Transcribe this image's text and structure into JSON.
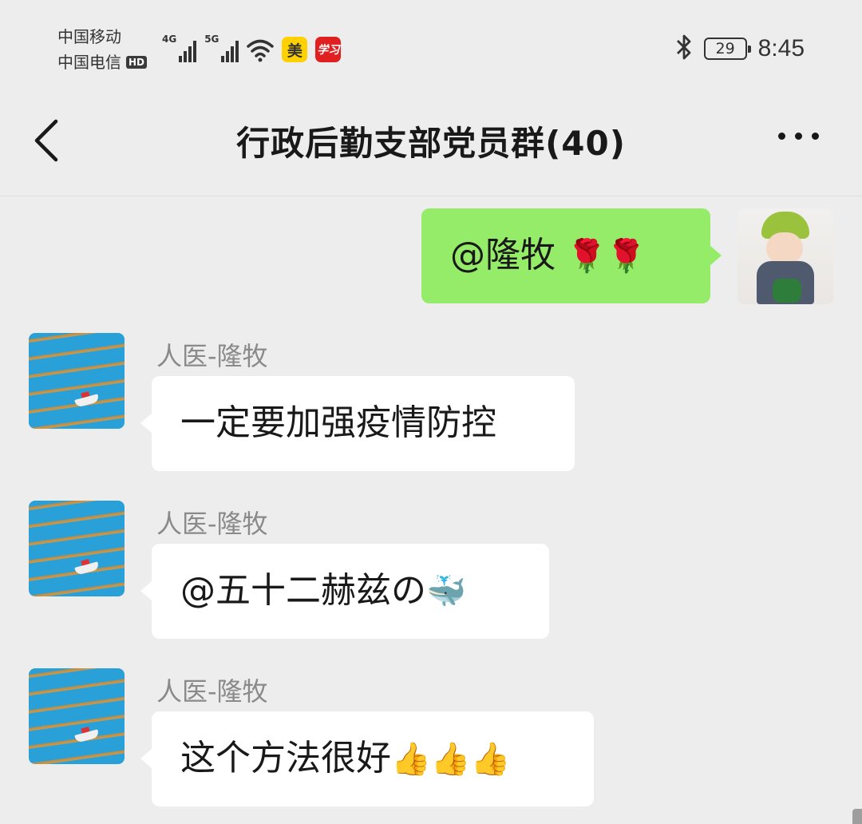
{
  "status_bar": {
    "carrier1": "中国移动",
    "carrier2": "中国电信",
    "hd_badge": "HD",
    "net1": "4G",
    "net2": "5G",
    "app_badge1": "美",
    "app_badge2": "学习",
    "battery": "29",
    "time": "8:45"
  },
  "header": {
    "title": "行政后勤支部党员群(40)"
  },
  "messages": [
    {
      "direction": "out",
      "text": "@隆牧 ",
      "emoji": "🌹🌹"
    },
    {
      "direction": "in",
      "sender": "人医-隆牧",
      "text": "一定要加强疫情防控"
    },
    {
      "direction": "in",
      "sender": "人医-隆牧",
      "text": "@五十二赫兹の",
      "emoji": "🐳"
    },
    {
      "direction": "in",
      "sender": "人医-隆牧",
      "text": "这个方法很好",
      "emoji": "👍👍👍"
    }
  ],
  "colors": {
    "background": "#ededed",
    "outgoing_bubble": "#95ec69",
    "incoming_bubble": "#ffffff"
  }
}
